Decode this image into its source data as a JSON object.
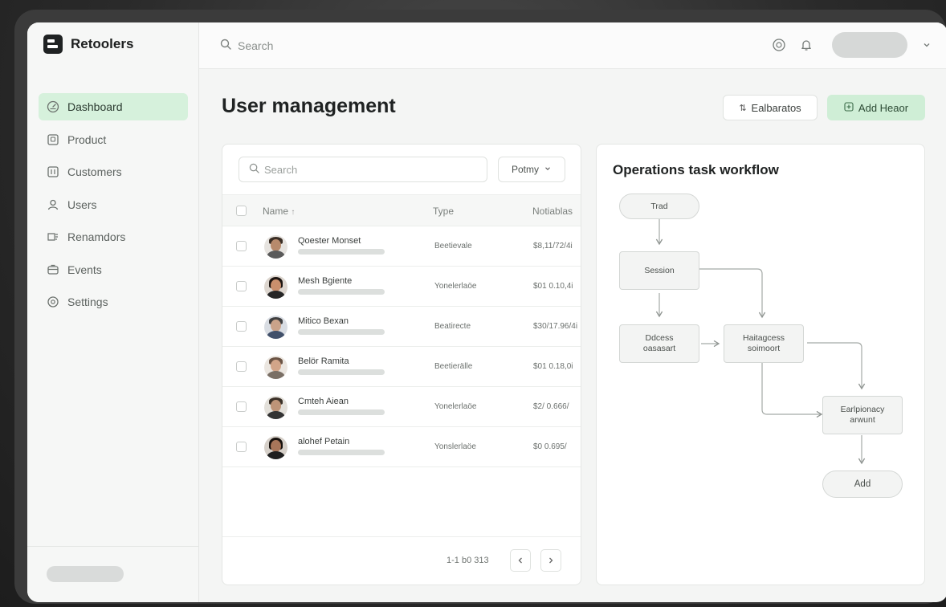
{
  "sidebar": {
    "brand": "Retoolers",
    "items": [
      {
        "label": "Dashboard",
        "icon": "dashboard-icon",
        "active": true
      },
      {
        "label": "Product",
        "icon": "product-icon",
        "active": false
      },
      {
        "label": "Customers",
        "icon": "customers-icon",
        "active": false
      },
      {
        "label": "Users",
        "icon": "user-icon",
        "active": false
      },
      {
        "label": "Renamdors",
        "icon": "reminders-icon",
        "active": false
      },
      {
        "label": "Events",
        "icon": "events-icon",
        "active": false
      },
      {
        "label": "Settings",
        "icon": "settings-icon",
        "active": false
      }
    ]
  },
  "topbar": {
    "search_placeholder": "Search"
  },
  "header": {
    "title": "User management",
    "secondary_button": "Ealbaratos",
    "primary_button": "Add Heaor"
  },
  "table": {
    "search_placeholder": "Search",
    "filter_label": "Potmy",
    "columns": [
      "Name",
      "Type",
      "Notiablas"
    ],
    "rows": [
      {
        "name": "Qoester Monset",
        "type": "Beetievale",
        "number": "$8,11/72/4i"
      },
      {
        "name": "Mesh Bgiente",
        "type": "Yonelerlaöe",
        "number": "$01 0.10,4i"
      },
      {
        "name": "Mitico Bexan",
        "type": "Beatirecte",
        "number": "$30/17.96/4i"
      },
      {
        "name": "Belör Ramita",
        "type": "Beetierälle",
        "number": "$01 0.18,0i"
      },
      {
        "name": "Cmteh Aiean",
        "type": "Yonelerlaöe",
        "number": "$2/ 0.666/"
      },
      {
        "name": "alohef Petain",
        "type": "Yonslerlaöe",
        "number": "$0 0.695/"
      }
    ],
    "pagination": "1-1 b0 313"
  },
  "workflow": {
    "title": "Operations task workflow",
    "nodes": {
      "start": "Trad",
      "session": "Session",
      "decision": "Ddcess oasasart",
      "management": "Haitagcess soimoort",
      "employment": "Earlpionacy arwunt",
      "add": "Add"
    }
  },
  "colors": {
    "accent_green_light": "#d6f1dc",
    "primary_button_bg": "#cfeed6",
    "background_dark": "#2b2b2b"
  }
}
